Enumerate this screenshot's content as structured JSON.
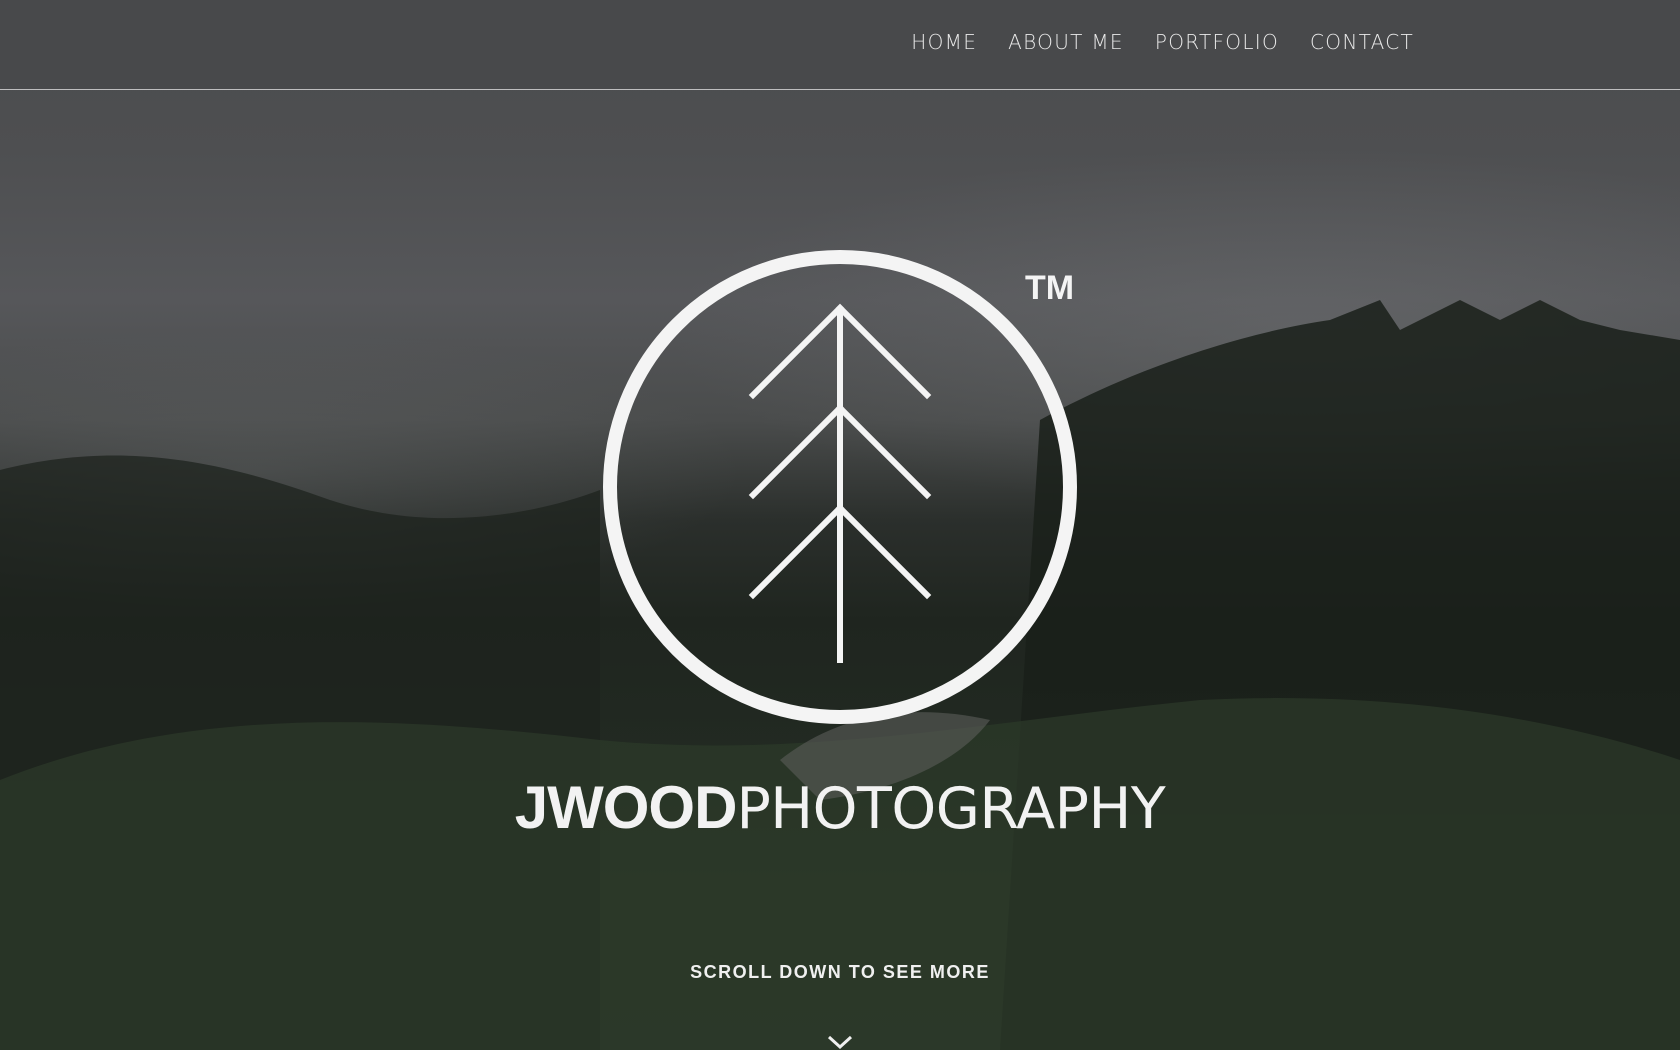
{
  "nav": {
    "items": [
      {
        "label": "HOME"
      },
      {
        "label": "ABOUT ME"
      },
      {
        "label": "PORTFOLIO"
      },
      {
        "label": "CONTACT"
      }
    ]
  },
  "hero": {
    "logo_icon": "tree-circle-logo-icon",
    "trademark": "TM",
    "brand_bold": "JWOOD",
    "brand_light": "PHOTOGRAPHY",
    "scroll_text": "SCROLL DOWN TO SEE MORE",
    "scroll_icon": "chevron-down-icon"
  },
  "colors": {
    "text": "#f2f2f2",
    "nav_bg": "#48494b"
  }
}
